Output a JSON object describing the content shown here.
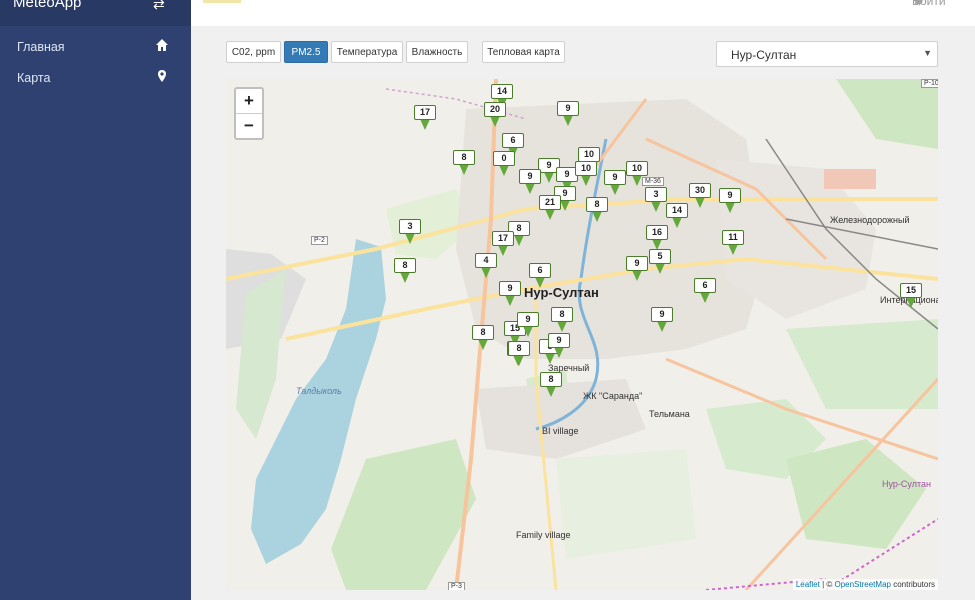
{
  "sidebar": {
    "app_title": "MeteoApp",
    "items": [
      {
        "label": "Главная",
        "icon": "home-icon"
      },
      {
        "label": "Карта",
        "icon": "map-marker-icon"
      }
    ]
  },
  "header": {
    "login_label": "Войти"
  },
  "toolbar": {
    "buttons": [
      {
        "label": "C02, ppm",
        "active": false
      },
      {
        "label": "PM2.5",
        "active": true
      },
      {
        "label": "Температура",
        "active": false
      },
      {
        "label": "Влажность",
        "active": false
      },
      {
        "label": "Тепловая карта",
        "active": false
      }
    ],
    "city_select": "Нур-Султан"
  },
  "map": {
    "zoom_in": "+",
    "zoom_out": "−",
    "labels": {
      "city": "Нур-Султан",
      "lake": "Талдыколь",
      "zhd": "Железнодорожный",
      "inter": "Интернациона",
      "zarech": "Заречный",
      "saranda": "ЖК \"Саранда\"",
      "telmana": "Тельмана",
      "bivillage": "BI village",
      "family": "Family village",
      "nursultan_road": "Нур-Султан",
      "r2": "Р-2",
      "r10": "Р-10",
      "m36": "М-36",
      "r3": "Р-3"
    },
    "markers": [
      "14",
      "17",
      "20",
      "9",
      "6",
      "8",
      "0",
      "10",
      "9",
      "9",
      "10",
      "9",
      "10",
      "9",
      "9",
      "30",
      "9",
      "21",
      "3",
      "8",
      "14",
      "3",
      "8",
      "17",
      "16",
      "11",
      "4",
      "8",
      "9",
      "5",
      "6",
      "15",
      "6",
      "9",
      "9",
      "8",
      "15",
      "8",
      "9",
      "4",
      "8",
      "9",
      "8",
      "8"
    ],
    "attribution": {
      "leaflet": "Leaflet",
      "sep": " | © ",
      "osm": "OpenStreetMap",
      "contrib": " contributors"
    }
  },
  "colors": {
    "sidebar": "#2e4170",
    "active_button": "#337ab7",
    "marker": "#64a83b"
  }
}
